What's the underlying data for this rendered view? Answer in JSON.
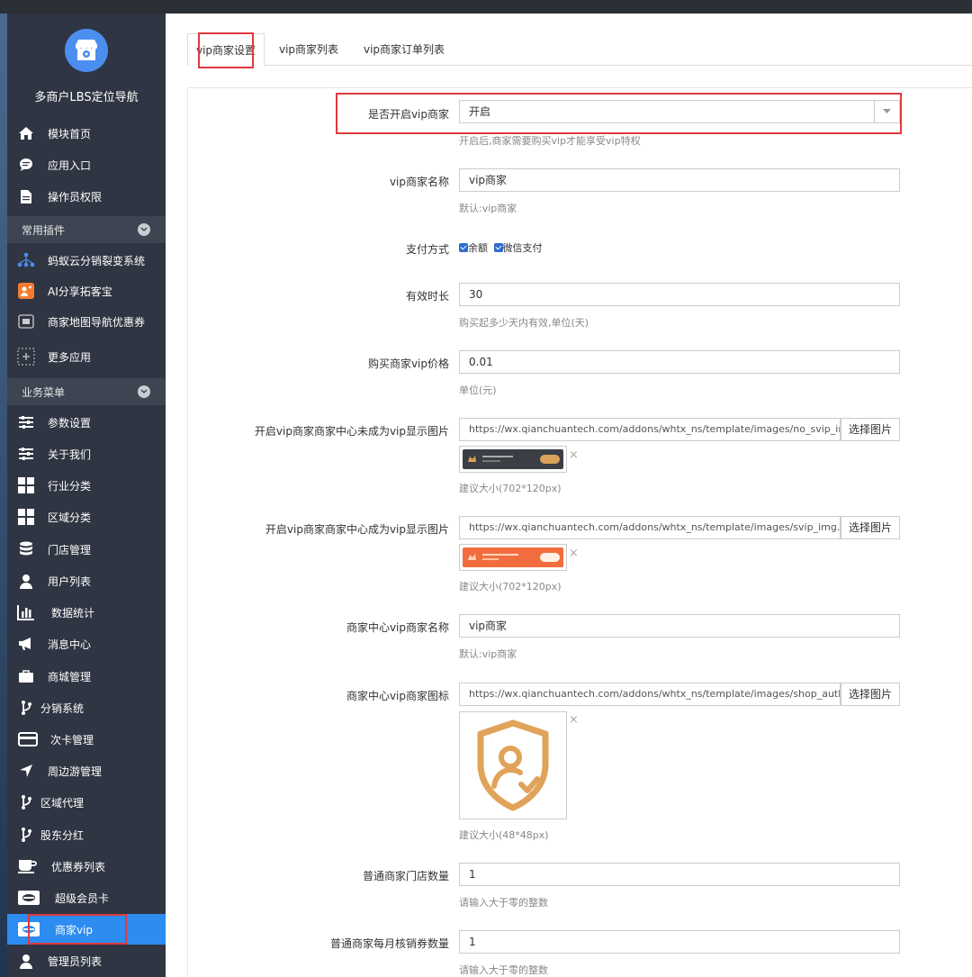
{
  "app": {
    "title": "多商户LBS定位导航"
  },
  "sidebar": {
    "top_items": [
      {
        "label": "模块首页",
        "icon": "home-icon"
      },
      {
        "label": "应用入口",
        "icon": "chat-icon"
      },
      {
        "label": "操作员权限",
        "icon": "document-icon"
      }
    ],
    "section_plugins": "常用插件",
    "plugins": [
      {
        "label": "蚂蚁云分销裂变系统",
        "icon": "network-icon"
      },
      {
        "label": "AI分享拓客宝",
        "icon": "ai-share-icon"
      },
      {
        "label": "商家地图导航优惠券",
        "icon": "map-coupon-icon"
      },
      {
        "label": "更多应用",
        "icon": "plus-box-icon"
      }
    ],
    "section_business": "业务菜单",
    "business": [
      {
        "label": "参数设置",
        "icon": "sliders-icon"
      },
      {
        "label": "关于我们",
        "icon": "sliders-icon"
      },
      {
        "label": "行业分类",
        "icon": "grid-icon"
      },
      {
        "label": "区域分类",
        "icon": "grid-icon"
      },
      {
        "label": "门店管理",
        "icon": "database-icon"
      },
      {
        "label": "用户列表",
        "icon": "user-icon"
      },
      {
        "label": "数据统计",
        "icon": "bar-chart-icon"
      },
      {
        "label": "消息中心",
        "icon": "megaphone-icon"
      },
      {
        "label": "商城管理",
        "icon": "briefcase-icon"
      },
      {
        "label": "分销系统",
        "icon": "branch-icon"
      },
      {
        "label": "次卡管理",
        "icon": "credit-card-icon"
      },
      {
        "label": "周边游管理",
        "icon": "location-arrow-icon"
      },
      {
        "label": "区域代理",
        "icon": "branch-icon"
      },
      {
        "label": "股东分红",
        "icon": "branch-icon"
      },
      {
        "label": "优惠券列表",
        "icon": "coffee-icon"
      },
      {
        "label": "超级会员卡",
        "icon": "cc-card-icon"
      },
      {
        "label": "商家vip",
        "icon": "cc-card-icon"
      },
      {
        "label": "管理员列表",
        "icon": "user-icon"
      }
    ]
  },
  "tabs": [
    {
      "label": "vip商家设置"
    },
    {
      "label": "vip商家列表"
    },
    {
      "label": "vip商家订单列表"
    }
  ],
  "form": {
    "enable_vip": {
      "label": "是否开启vip商家",
      "value": "开启",
      "hint": "开启后,商家需要购买vip才能享受vip特权"
    },
    "vip_name": {
      "label": "vip商家名称",
      "value": "vip商家",
      "hint": "默认:vip商家"
    },
    "payment": {
      "label": "支付方式",
      "options": [
        "余额",
        "微信支付"
      ]
    },
    "duration": {
      "label": "有效时长",
      "value": "30",
      "hint": "购买起多少天内有效,单位(天)"
    },
    "price": {
      "label": "购买商家vip价格",
      "value": "0.01",
      "hint": "单位(元)"
    },
    "img_non_vip": {
      "label": "开启vip商家商家中心未成为vip显示图片",
      "value": "https://wx.qianchuantech.com/addons/whtx_ns/template/images/no_svip_img.png",
      "button": "选择图片",
      "hint": "建议大小(702*120px)"
    },
    "img_vip": {
      "label": "开启vip商家商家中心成为vip显示图片",
      "value": "https://wx.qianchuantech.com/addons/whtx_ns/template/images/svip_img.png",
      "button": "选择图片",
      "hint": "建议大小(702*120px)"
    },
    "center_vip_name": {
      "label": "商家中心vip商家名称",
      "value": "vip商家",
      "hint": "默认:vip商家"
    },
    "center_vip_icon": {
      "label": "商家中心vip商家图标",
      "value": "https://wx.qianchuantech.com/addons/whtx_ns/template/images/shop_auth.png",
      "button": "选择图片",
      "hint": "建议大小(48*48px)"
    },
    "normal_store_count": {
      "label": "普通商家门店数量",
      "value": "1",
      "hint": "请输入大于零的整数"
    },
    "normal_monthly_verify": {
      "label": "普通商家每月核销券数量",
      "value": "1",
      "hint": "请输入大于零的整数"
    }
  },
  "remove_mark": "×",
  "colors": {
    "sidebar_bg": "#2f3542",
    "active": "#2d8cf0",
    "highlight": "#e0393e",
    "section_bg": "#3d4452"
  }
}
